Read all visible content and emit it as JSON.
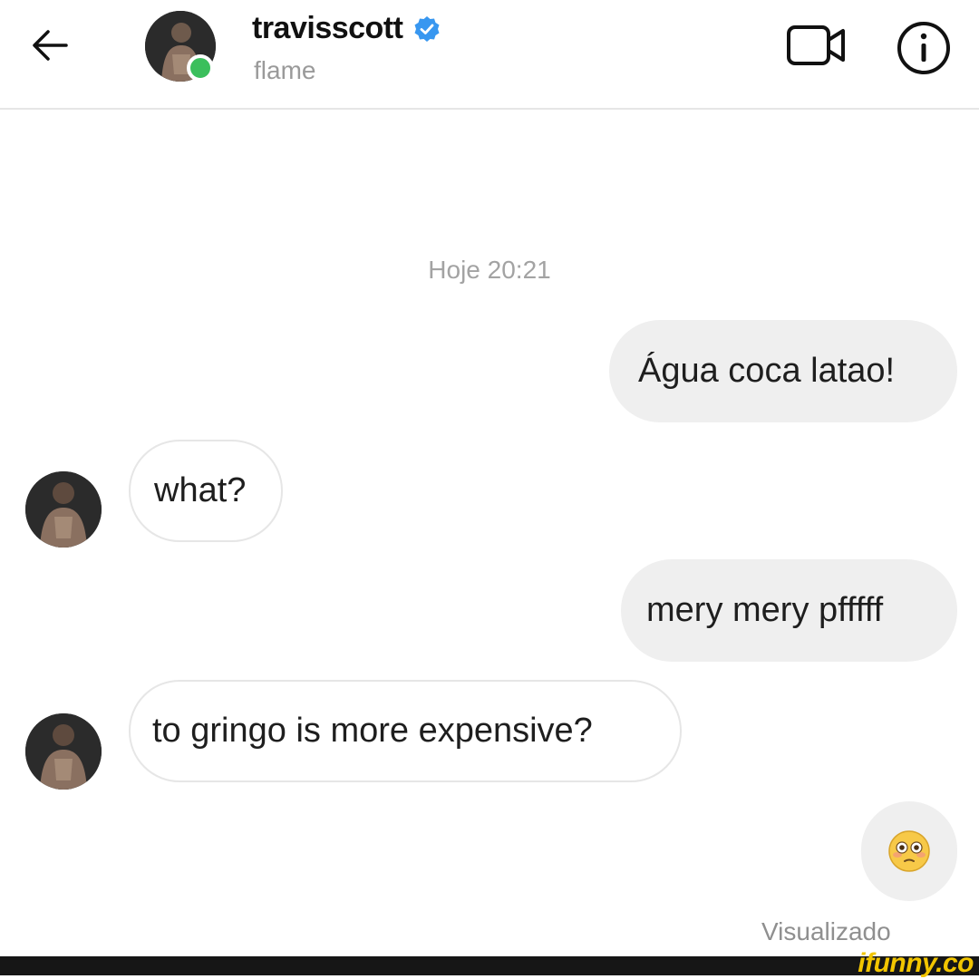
{
  "header": {
    "username": "travisscott",
    "status": "flame",
    "online": true,
    "verified": true,
    "icons": {
      "back": "arrow-left-icon",
      "video": "video-call-icon",
      "info": "info-icon",
      "verified": "verified-badge-icon"
    }
  },
  "conversation": {
    "timestamp": "Hoje 20:21",
    "messages": [
      {
        "direction": "outgoing",
        "text": "Água coca latao!"
      },
      {
        "direction": "incoming",
        "text": "what?"
      },
      {
        "direction": "outgoing",
        "text": "mery mery pfffff"
      },
      {
        "direction": "incoming",
        "text": "to gringo is more expensive?"
      },
      {
        "direction": "outgoing",
        "emoji": "😳"
      }
    ],
    "seen_status": "Visualizado"
  },
  "watermark": "ifunny.co",
  "colors": {
    "outgoing_bubble": "#efefef",
    "incoming_border": "#e6e6e6",
    "online": "#3bbf5c",
    "verified": "#3897f0",
    "watermark": "#f2c500"
  }
}
